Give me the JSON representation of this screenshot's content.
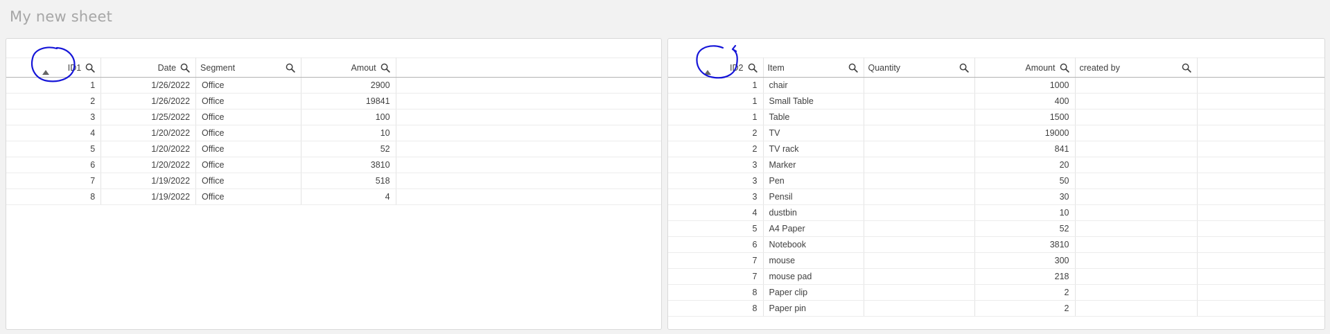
{
  "sheet": {
    "title": "My new sheet"
  },
  "left_table": {
    "columns": [
      "ID1",
      "Date",
      "Segment",
      "Amout"
    ],
    "rows": [
      [
        "1",
        "1/26/2022",
        "Office",
        "2900"
      ],
      [
        "2",
        "1/26/2022",
        "Office",
        "19841"
      ],
      [
        "3",
        "1/25/2022",
        "Office",
        "100"
      ],
      [
        "4",
        "1/20/2022",
        "Office",
        "10"
      ],
      [
        "5",
        "1/20/2022",
        "Office",
        "52"
      ],
      [
        "6",
        "1/20/2022",
        "Office",
        "3810"
      ],
      [
        "7",
        "1/19/2022",
        "Office",
        "518"
      ],
      [
        "8",
        "1/19/2022",
        "Office",
        "4"
      ]
    ]
  },
  "right_table": {
    "columns": [
      "ID2",
      "Item",
      "Quantity",
      "Amount",
      "created by"
    ],
    "rows": [
      [
        "1",
        "chair",
        "",
        "1000",
        ""
      ],
      [
        "1",
        "Small Table",
        "",
        "400",
        ""
      ],
      [
        "1",
        "Table",
        "",
        "1500",
        ""
      ],
      [
        "2",
        "TV",
        "",
        "19000",
        ""
      ],
      [
        "2",
        "TV rack",
        "",
        "841",
        ""
      ],
      [
        "3",
        "Marker",
        "",
        "20",
        ""
      ],
      [
        "3",
        "Pen",
        "",
        "50",
        ""
      ],
      [
        "3",
        "Pensil",
        "",
        "30",
        ""
      ],
      [
        "4",
        "dustbin",
        "",
        "10",
        ""
      ],
      [
        "5",
        "A4 Paper",
        "",
        "52",
        ""
      ],
      [
        "6",
        "Notebook",
        "",
        "3810",
        ""
      ],
      [
        "7",
        "mouse",
        "",
        "300",
        ""
      ],
      [
        "7",
        "mouse pad",
        "",
        "218",
        ""
      ],
      [
        "8",
        "Paper clip",
        "",
        "2",
        ""
      ],
      [
        "8",
        "Paper pin",
        "",
        "2",
        ""
      ]
    ]
  },
  "icons": {
    "column_search": "search-icon",
    "sort_ascending": "sort-ascending-icon"
  },
  "colors": {
    "background": "#f2f2f2",
    "panel": "#ffffff",
    "annotation_ink": "#1515d8",
    "title_text": "#a6a6a6"
  }
}
